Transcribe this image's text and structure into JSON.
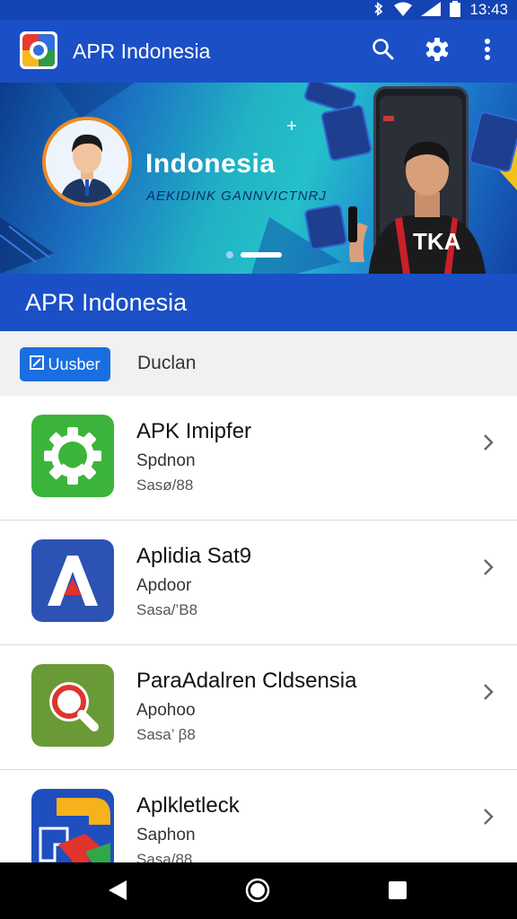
{
  "status_bar": {
    "time": "13:43",
    "icons": [
      "bluetooth-icon",
      "wifi-icon",
      "signal-icon",
      "battery-icon"
    ]
  },
  "app_bar": {
    "title": "APR Indonesia",
    "actions": [
      "search-icon",
      "gear-icon",
      "more-vert-icon"
    ]
  },
  "banner": {
    "headline": "Indonesia",
    "subtitle": "AEKIDINK GANNVICTNRJ",
    "page_count": 2,
    "active_page": 2
  },
  "section": {
    "title": "APR Indonesia"
  },
  "filters": {
    "active_label": "Uusber",
    "inactive_label": "Duclan"
  },
  "apps": [
    {
      "title": "APK Imipfer",
      "subtitle": "Spdnon",
      "meta": "Sasø/88",
      "icon": "green-gear-icon"
    },
    {
      "title": "Aplidia Sat9",
      "subtitle": "Apdoor",
      "meta": "Sasa/’B8",
      "icon": "blue-a-logo-icon"
    },
    {
      "title": "ParaAdalren Cldsensia",
      "subtitle": "Apohoo",
      "meta": "Sasa’ β8",
      "icon": "green-magnifier-icon"
    },
    {
      "title": "Aplkletleck",
      "subtitle": "Saphon",
      "meta": "Sasa/88",
      "icon": "multicolor-logo-icon"
    }
  ],
  "nav_bar": [
    "back-icon",
    "home-icon",
    "recent-apps-icon"
  ],
  "colors": {
    "primary": "#1a4fc6",
    "status_bar": "#1443b4",
    "chip": "#1a6ee0",
    "filter_bg": "#f1f1f1"
  }
}
